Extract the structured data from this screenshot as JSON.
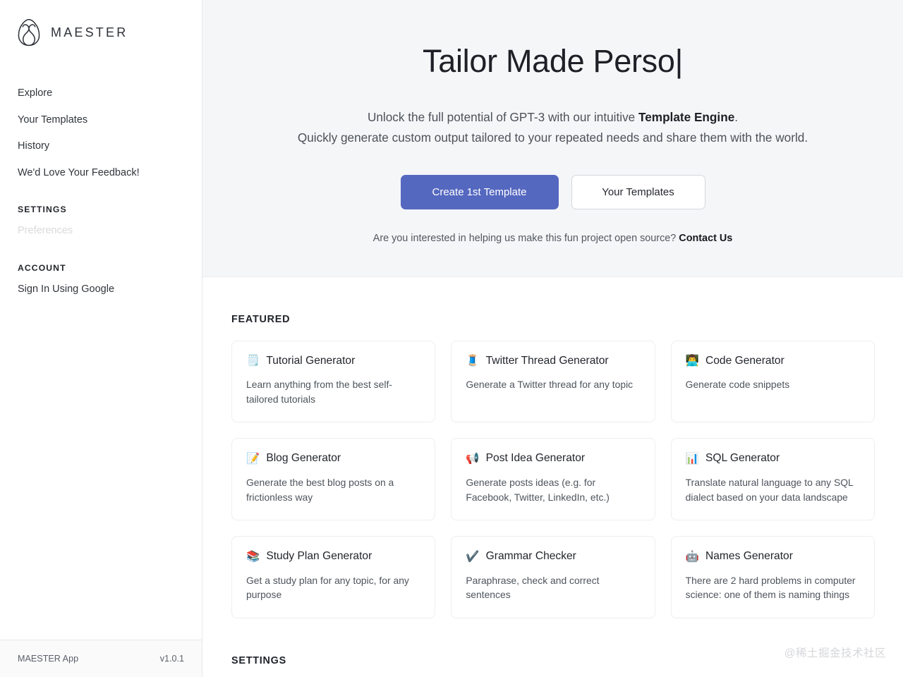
{
  "sidebar": {
    "brand": {
      "name": "MAESTER",
      "logo_icon": "maester-tulip-logo-icon"
    },
    "nav": [
      {
        "label": "Explore",
        "muted": false
      },
      {
        "label": "Your Templates",
        "muted": false
      },
      {
        "label": "History",
        "muted": false
      },
      {
        "label": "We'd Love Your Feedback!",
        "muted": false
      }
    ],
    "settings_section": {
      "header": "SETTINGS",
      "items": [
        {
          "label": "Preferences",
          "muted": true
        }
      ]
    },
    "account_section": {
      "header": "ACCOUNT",
      "items": [
        {
          "label": "Sign In Using Google",
          "muted": false
        }
      ]
    },
    "footer": {
      "app_name": "MAESTER App",
      "version": "v1.0.1"
    }
  },
  "hero": {
    "title": "Tailor Made Perso",
    "caret": "|",
    "sub_line1_pre": "Unlock the full potential of GPT-3 with our intuitive ",
    "sub_line1_bold": "Template Engine",
    "sub_line1_post": ".",
    "sub_line2": "Quickly generate custom output tailored to your repeated needs and share them with the world.",
    "primary_button": "Create 1st Template",
    "secondary_button": "Your Templates",
    "note_pre": "Are you interested in helping us make this fun project open source? ",
    "note_link": "Contact Us"
  },
  "featured": {
    "heading": "FEATURED",
    "cards": [
      {
        "emoji": "🗒️",
        "icon_name": "spiral-notepad-icon",
        "title": "Tutorial Generator",
        "desc": "Learn anything from the best self-tailored tutorials"
      },
      {
        "emoji": "🧵",
        "icon_name": "thread-spool-icon",
        "title": "Twitter Thread Generator",
        "desc": "Generate a Twitter thread for any topic"
      },
      {
        "emoji": "👨‍💻",
        "icon_name": "technologist-icon",
        "title": "Code Generator",
        "desc": "Generate code snippets"
      },
      {
        "emoji": "📝",
        "icon_name": "memo-icon",
        "title": "Blog Generator",
        "desc": "Generate the best blog posts on a frictionless way"
      },
      {
        "emoji": "📢",
        "icon_name": "loudspeaker-icon",
        "title": "Post Idea Generator",
        "desc": "Generate posts ideas (e.g. for Facebook, Twitter, LinkedIn, etc.)"
      },
      {
        "emoji": "📊",
        "icon_name": "bar-chart-icon",
        "title": "SQL Generator",
        "desc": "Translate natural language to any SQL dialect based on your data landscape"
      },
      {
        "emoji": "📚",
        "icon_name": "books-icon",
        "title": "Study Plan Generator",
        "desc": "Get a study plan for any topic, for any purpose"
      },
      {
        "emoji": "✔️",
        "icon_name": "check-mark-icon",
        "title": "Grammar Checker",
        "desc": "Paraphrase, check and correct sentences"
      },
      {
        "emoji": "🤖",
        "icon_name": "robot-icon",
        "title": "Names Generator",
        "desc": "There are 2 hard problems in computer science: one of them is naming things"
      }
    ]
  },
  "settings_section": {
    "heading": "SETTINGS"
  },
  "watermark": {
    "text": "@稀土掘金技术社区"
  },
  "colors": {
    "accent": "#5568c0",
    "hero_bg": "#f5f6f8",
    "border": "#eceef1",
    "text": "#22252b"
  }
}
